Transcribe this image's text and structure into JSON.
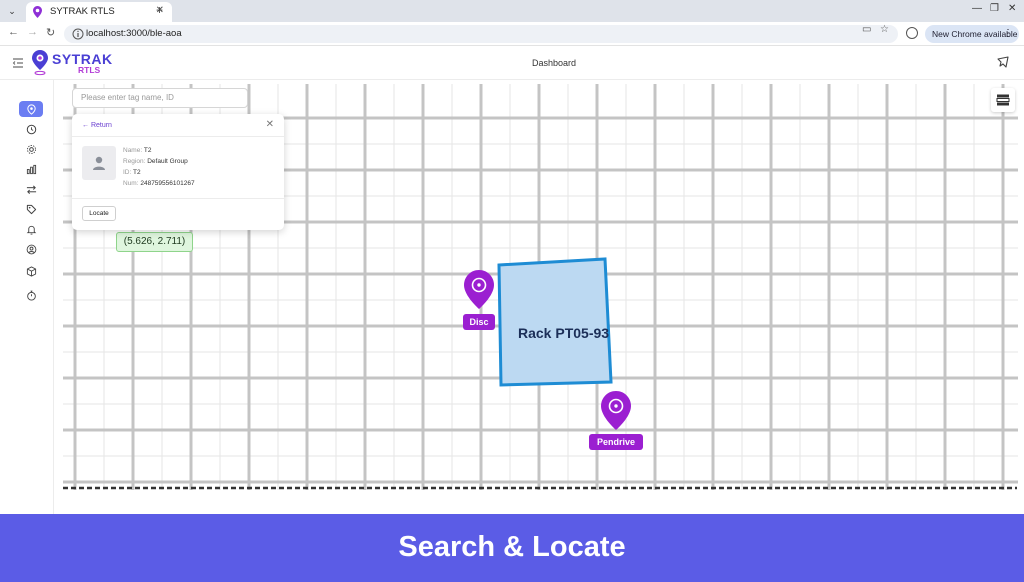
{
  "browser": {
    "tab_title": "SYTRAK RTLS",
    "url": "localhost:3000/ble-aoa",
    "update_label": "New Chrome available"
  },
  "app": {
    "logo_name": "SYTRAK",
    "logo_sub": "RTLS",
    "page_title": "Dashboard"
  },
  "sidebar": {
    "items": [
      {
        "icon": "location-pin-icon",
        "active": true
      },
      {
        "icon": "clock-icon",
        "active": false
      },
      {
        "icon": "settings-icon",
        "active": false
      },
      {
        "icon": "bar-chart-icon",
        "active": false
      },
      {
        "icon": "swap-arrows-icon",
        "active": false
      },
      {
        "icon": "tag-icon",
        "active": false
      },
      {
        "icon": "bell-icon",
        "active": false
      },
      {
        "icon": "user-circle-icon",
        "active": false
      },
      {
        "icon": "package-icon",
        "active": false
      },
      {
        "icon": "stopwatch-icon",
        "active": false
      }
    ]
  },
  "search": {
    "placeholder": "Please enter tag name, ID"
  },
  "info_card": {
    "return_label": "← Return",
    "close_label": "✕",
    "name_label": "Name:",
    "name_value": "T2",
    "region_label": "Region:",
    "region_value": "Default Group",
    "id_label": "ID:",
    "id_value": "T2",
    "num_label": "Num:",
    "num_value": "248759556101267",
    "locate_label": "Locate"
  },
  "map": {
    "coord_badge": "(5.626, 2.711)",
    "tags": [
      {
        "label": "Disc",
        "color": "#9b1fd1"
      },
      {
        "label": "Pendrive",
        "color": "#9b1fd1"
      }
    ],
    "rack": {
      "label": "Rack PT05-93",
      "fill": "#bcd9f2",
      "stroke": "#1e8cd4"
    }
  },
  "banner": {
    "text": "Search & Locate",
    "color": "#5b5ce6"
  }
}
